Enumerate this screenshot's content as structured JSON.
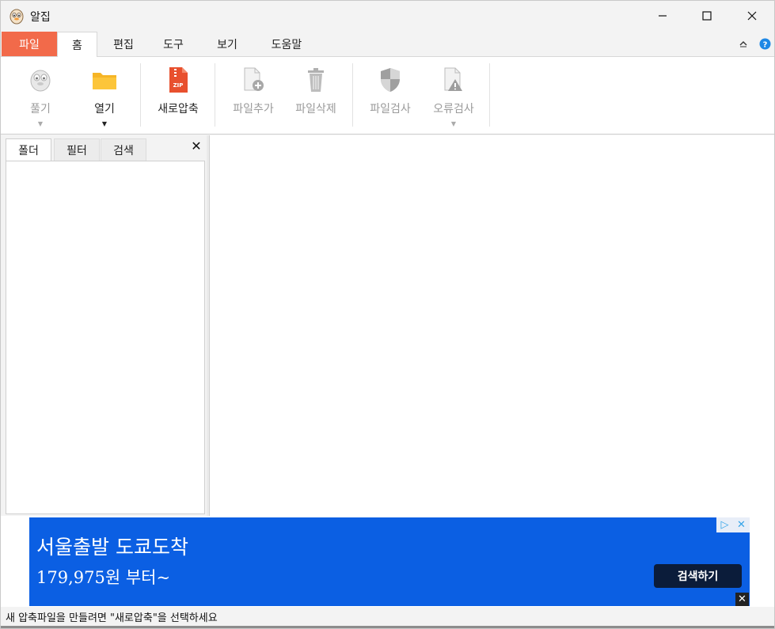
{
  "window": {
    "title": "알집"
  },
  "menu": {
    "tabs": [
      {
        "label": "파일"
      },
      {
        "label": "홈"
      },
      {
        "label": "편집"
      },
      {
        "label": "도구"
      },
      {
        "label": "보기"
      },
      {
        "label": "도움말"
      }
    ]
  },
  "ribbon": {
    "buttons": [
      {
        "label": "풀기",
        "icon": "alzip-mascot-icon",
        "enabled": false,
        "has_dropdown": true
      },
      {
        "label": "열기",
        "icon": "folder-icon",
        "enabled": true,
        "has_dropdown": true
      },
      {
        "label": "새로압축",
        "icon": "zip-file-icon",
        "enabled": true,
        "has_dropdown": false
      },
      {
        "label": "파일추가",
        "icon": "file-add-icon",
        "enabled": false,
        "has_dropdown": false
      },
      {
        "label": "파일삭제",
        "icon": "trash-icon",
        "enabled": false,
        "has_dropdown": false
      },
      {
        "label": "파일검사",
        "icon": "shield-icon",
        "enabled": false,
        "has_dropdown": false
      },
      {
        "label": "오류검사",
        "icon": "warning-file-icon",
        "enabled": false,
        "has_dropdown": true
      }
    ]
  },
  "left_panel": {
    "tabs": [
      {
        "label": "폴더"
      },
      {
        "label": "필터"
      },
      {
        "label": "검색"
      }
    ],
    "close_glyph": "✕"
  },
  "ad": {
    "headline": "서울출발 도쿄도착",
    "price": "179,975원 부터~",
    "cta": "검색하기",
    "choices_glyph": "▷",
    "close_glyph": "✕",
    "background_color": "#0b5fe3",
    "cta_color": "#0b1c3a"
  },
  "statusbar": {
    "text": "새 압축파일을 만들려면 \"새로압축\"을 선택하세요"
  },
  "colors": {
    "file_tab": "#f26a4a",
    "help_icon": "#1e88e5",
    "folder": "#f6b526",
    "zip": "#e8502e"
  }
}
